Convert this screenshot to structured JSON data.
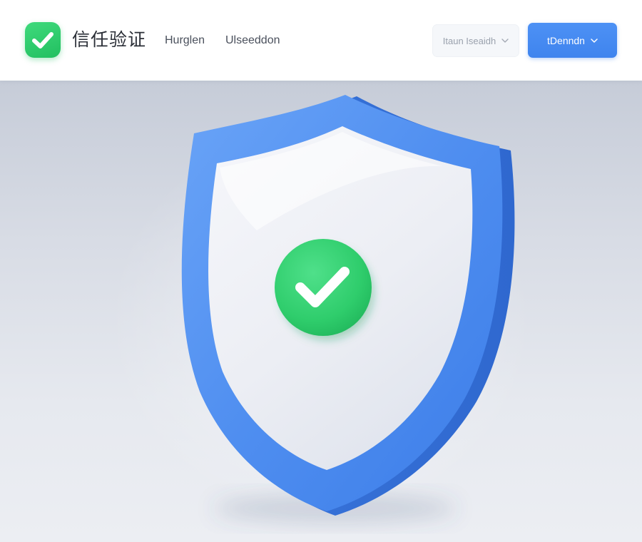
{
  "header": {
    "brand_title": "信任验证",
    "nav": [
      {
        "label": "Hurglen"
      },
      {
        "label": "Ulseeddon"
      }
    ],
    "select_button": {
      "label": "Itaun Iseaidh"
    },
    "primary_button": {
      "label": "tDenndn"
    }
  },
  "icons": {
    "logo": "check-icon",
    "select_chevron": "chevron-down-icon",
    "primary_chevron": "chevron-down-icon",
    "hero": "shield-check-icon"
  },
  "colors": {
    "brand_green": "#2ccb6b",
    "primary_blue": "#4a8df3",
    "shield_blue": "#4e8ef0",
    "shield_face": "#eef0f6",
    "header_bg": "#ffffff",
    "hero_bg": "#d8dce5"
  }
}
